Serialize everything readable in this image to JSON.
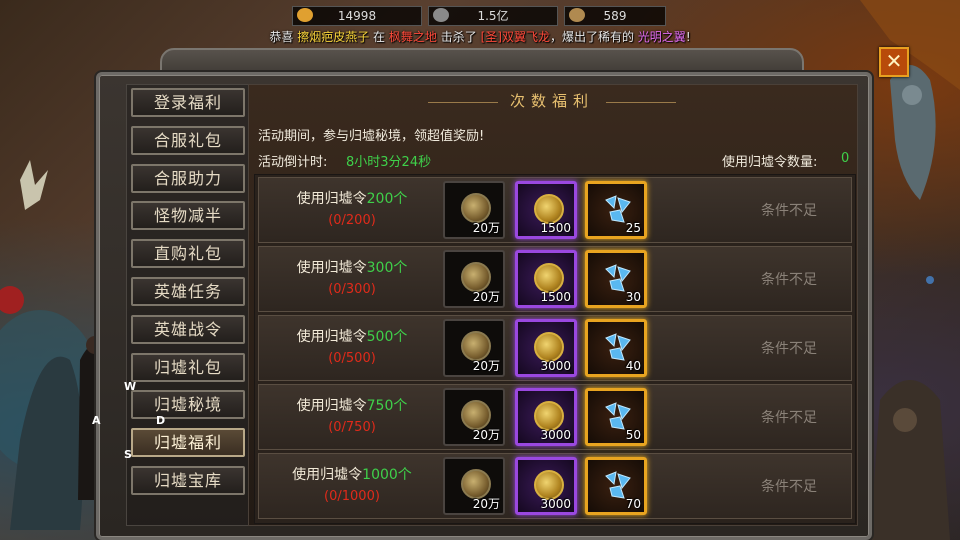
{
  "resources": [
    {
      "icon": "gold-ingot-icon",
      "value": "14998"
    },
    {
      "icon": "silver-coin-icon",
      "value": "1.5亿"
    },
    {
      "icon": "horn-icon",
      "value": "589"
    }
  ],
  "notice": {
    "p1": "恭喜",
    "player": "擦烟疤皮燕子",
    "p2": "在",
    "place": "枫舞之地",
    "p3": "击杀了",
    "monster": "[圣]双翼飞龙",
    "p4": "，爆出了稀有的",
    "item": "光明之翼",
    "p5": "!"
  },
  "controls": {
    "w": "W",
    "a": "A",
    "s": "S",
    "d": "D"
  },
  "close_label": "✕",
  "menu": [
    {
      "label": "登录福利",
      "active": false
    },
    {
      "label": "合服礼包",
      "active": false
    },
    {
      "label": "合服助力",
      "active": false
    },
    {
      "label": "怪物减半",
      "active": false
    },
    {
      "label": "直购礼包",
      "active": false
    },
    {
      "label": "英雄任务",
      "active": false
    },
    {
      "label": "英雄战令",
      "active": false
    },
    {
      "label": "归墟礼包",
      "active": false
    },
    {
      "label": "归墟秘境",
      "active": false
    },
    {
      "label": "归墟福利",
      "active": true
    },
    {
      "label": "归墟宝库",
      "active": false
    }
  ],
  "panel": {
    "title": "次数福利",
    "description": "活动期间，参与归墟秘境，领超值奖励!",
    "countdown_label": "活动倒计时:",
    "countdown_value": "8小时3分24秒",
    "count_label": "使用归墟令数量:",
    "count_value": "0"
  },
  "rows": [
    {
      "prefix": "使用归墟令",
      "amount": "200个",
      "progress": "(0/200)",
      "rewards": [
        "20万",
        "1500",
        "25"
      ],
      "status": "条件不足"
    },
    {
      "prefix": "使用归墟令",
      "amount": "300个",
      "progress": "(0/300)",
      "rewards": [
        "20万",
        "1500",
        "30"
      ],
      "status": "条件不足"
    },
    {
      "prefix": "使用归墟令",
      "amount": "500个",
      "progress": "(0/500)",
      "rewards": [
        "20万",
        "3000",
        "40"
      ],
      "status": "条件不足"
    },
    {
      "prefix": "使用归墟令",
      "amount": "750个",
      "progress": "(0/750)",
      "rewards": [
        "20万",
        "3000",
        "50"
      ],
      "status": "条件不足"
    },
    {
      "prefix": "使用归墟令",
      "amount": "1000个",
      "progress": "(0/1000)",
      "rewards": [
        "20万",
        "3000",
        "70"
      ],
      "status": "条件不足"
    }
  ],
  "colors": {
    "highlight_green": "#3fd04a",
    "progress_red": "#e02a1a",
    "epic_purple": "#9a48e0",
    "legend_gold": "#e8a420"
  }
}
